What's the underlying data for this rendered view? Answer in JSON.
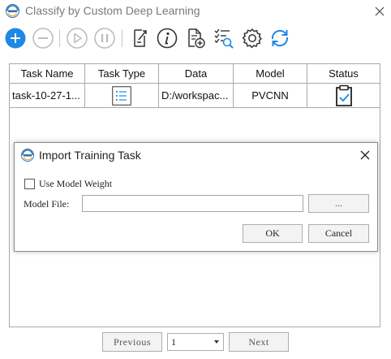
{
  "window": {
    "title": "Classify by Custom Deep Learning"
  },
  "toolbar": {
    "icons": [
      "add-icon",
      "remove-icon",
      "play-icon",
      "pause-icon",
      "export-icon",
      "info-icon",
      "add-file-icon",
      "checklist-search-icon",
      "settings-icon",
      "refresh-icon"
    ],
    "accent_color": "#1e88e5",
    "disabled_color": "#bdbdbd"
  },
  "table": {
    "columns": [
      "Task Name",
      "Task Type",
      "Data",
      "Model",
      "Status"
    ],
    "rows": [
      {
        "task_name": "task-10-27-1...",
        "task_type_icon": "list-icon",
        "data": "D:/workspac...",
        "model": "PVCNN",
        "status_icon": "clipboard-check-icon"
      }
    ]
  },
  "pager": {
    "previous_label": "Previous",
    "page_value": "1",
    "next_label": "Next"
  },
  "dialog": {
    "title": "Import Training Task",
    "use_model_weight_label": "Use Model Weight",
    "use_model_weight_checked": false,
    "model_file_label": "Model File:",
    "model_file_value": "",
    "browse_label": "...",
    "ok_label": "OK",
    "cancel_label": "Cancel"
  }
}
